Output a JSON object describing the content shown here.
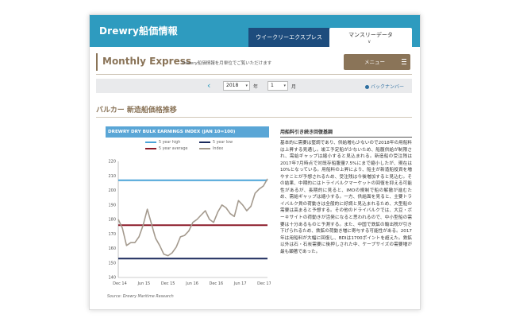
{
  "brand": "Drewry船価情報",
  "tabs": {
    "weekly": "ウイークリーエクスプレス",
    "monthly": "マンスリーデータ"
  },
  "header": {
    "title": "Monthly Express",
    "subtitle": "Drewry船価情報を月単位でご覧いただけます",
    "menu_label": "メニュー"
  },
  "date_nav": {
    "year_value": "2018",
    "year_unit": "年",
    "month_value": "1",
    "month_unit": "月",
    "back_numbers": "バックナンバー"
  },
  "section_title": "バルカー 新造船価格推移",
  "article": {
    "title": "用船料引き続き回復基調",
    "body": "基本的に需要は堅調であり、供給増も少ないので2018年の用船料は上昇する見通し。竣工予定船が少ないため、船腹供給が制限され、需給ギャップは縮小すると見込まれる。新造船の受注残は2017年7月時点で対既存船腹量7.5%にまで縮小したが、現在は10%となっている。用船料の上昇により、船主が新造船投資を増やすことが予想されるため、受注残は今後増加すると見込む。その結果、中期的にはトライバルクマーケットの回復を抑える可能性があるが、長期的に見ると、IMOの規制で船の解撤が進むため、需給ギャップは縮小する。一方、供給面を見ると、主要トライバルク貨の荷動きは全般的に好調と見込まれるため、大型船の需要は高まると予想する。その他のドライバルクでは、大豆・ボーキサイトの荷動きが活発になると思われるので、中小型船の需要は十分あるものと予測する。また、中国で鉄鉱の輸出税が引き下げられるため、鉄鉱の荷動き増に寄与する可能性がある。2017年は用船料が大幅に回復し、BDIは1700ポイントを超えた。鉄鉱以外は石・石炭需要に後押しされた中、ケープサイズの需要増が最も顕著であった。"
  },
  "chart_data": {
    "type": "line",
    "title": "DREWRY DRY BULK EARNINGS INDEX (JAN 10=100)",
    "source": "Source: Drewry Maritime Research",
    "x": [
      "Dec 14",
      "Jun 15",
      "Dec 15",
      "Jun 16",
      "Dec 16",
      "Jun 17",
      "Dec 17"
    ],
    "ylim": [
      140,
      220
    ],
    "yticks": [
      140,
      150,
      160,
      170,
      180,
      190,
      200,
      210,
      220
    ],
    "legend": [
      "5 year high",
      "5 year low",
      "5 year average",
      "Index"
    ],
    "colors": {
      "high": "#4aa3d8",
      "low": "#1b2a5c",
      "average": "#8b1a28",
      "index": "#a49a8e"
    },
    "series": [
      {
        "name": "5 year high",
        "values": [
          207,
          207
        ]
      },
      {
        "name": "5 year low",
        "values": [
          153,
          153
        ]
      },
      {
        "name": "5 year average",
        "values": [
          176,
          176
        ]
      },
      {
        "name": "Index",
        "values": [
          180,
          174,
          162,
          164,
          164,
          168,
          176,
          187,
          177,
          167,
          162,
          156,
          155,
          157,
          161,
          168,
          169,
          172,
          178,
          180,
          183,
          186,
          180,
          178,
          185,
          190,
          188,
          184,
          182,
          193,
          190,
          186,
          189,
          198,
          201,
          203,
          208
        ]
      }
    ]
  }
}
